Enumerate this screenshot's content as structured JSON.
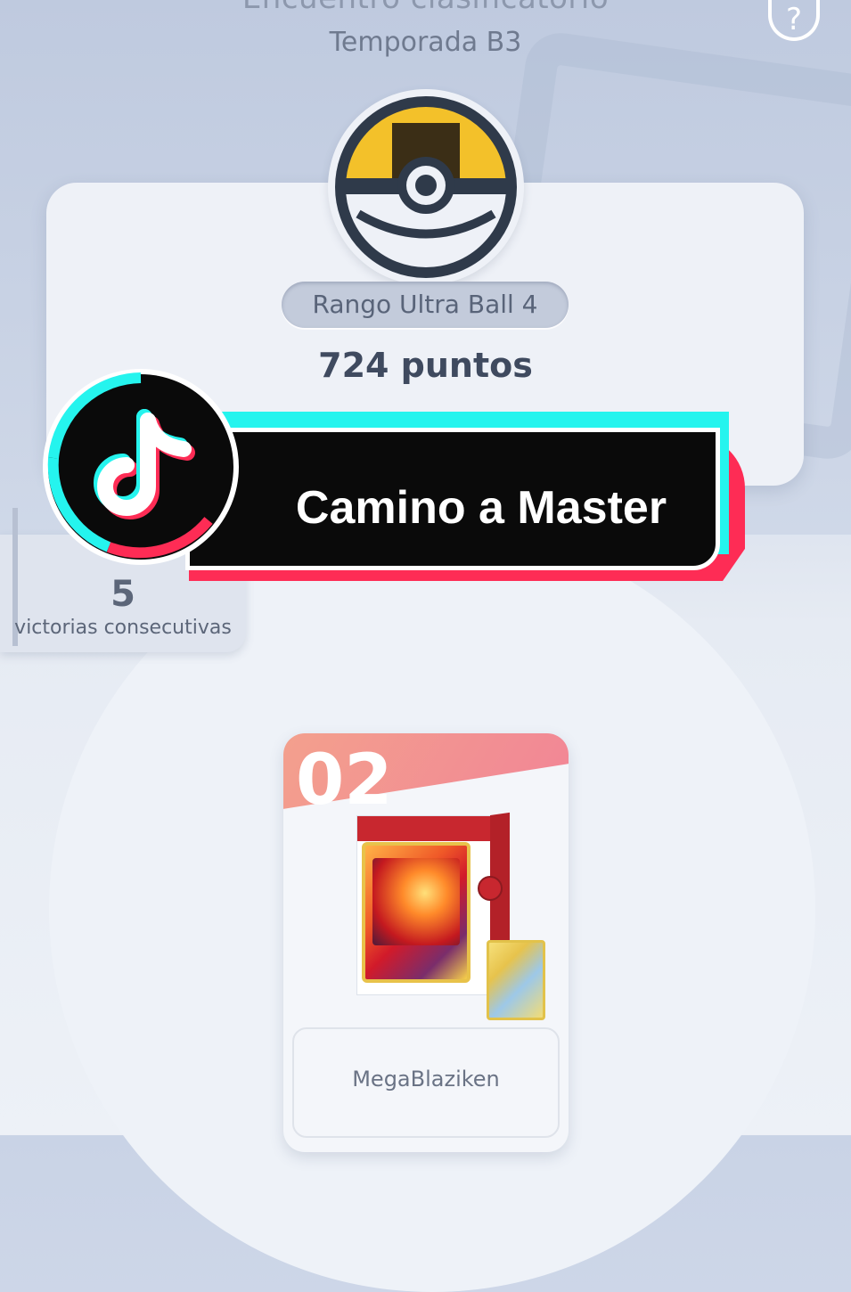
{
  "header": {
    "title": "Encuentro clasificatorio",
    "subtitle": "Temporada B3",
    "help_icon": "question-mark-circle-icon"
  },
  "rank": {
    "ball_icon": "ultra-ball-icon",
    "label": "Rango Ultra Ball 4",
    "points": "724 puntos"
  },
  "streak": {
    "count": "5",
    "label": "victorias consecutivas"
  },
  "overlay": {
    "logo_icon": "tiktok-logo-icon",
    "text": "Camino a Master",
    "colors": {
      "cyan": "#25f4ee",
      "red": "#fe2c55",
      "black": "#0a0a0a"
    }
  },
  "deck": {
    "number": "02",
    "name": "MegaBlaziken",
    "colors": {
      "header_start": "#f3a08d",
      "header_end": "#f28397",
      "box": "#c8272f"
    }
  }
}
